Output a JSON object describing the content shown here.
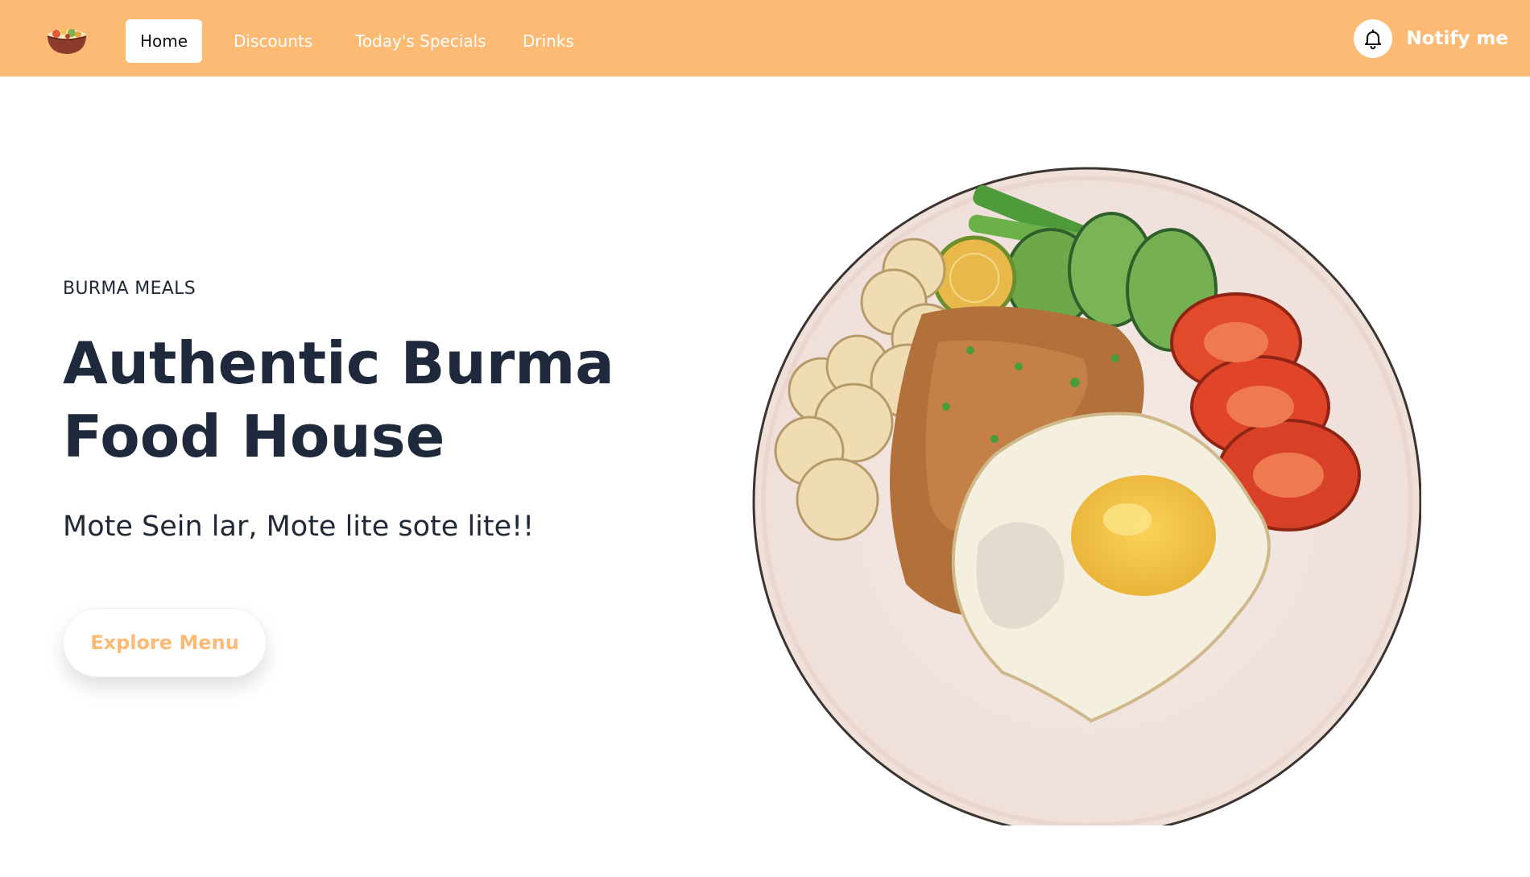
{
  "nav": {
    "logo_icon": "food-bowl-icon",
    "links": [
      {
        "label": "Home",
        "active": true
      },
      {
        "label": "Discounts",
        "active": false
      },
      {
        "label": "Today's Specials",
        "active": false
      },
      {
        "label": "Drinks",
        "active": false
      }
    ],
    "notify": {
      "label": "Notify me",
      "icon": "bell-icon"
    }
  },
  "hero": {
    "eyebrow": "BURMA MEALS",
    "title_line1": "Authentic Burma",
    "title_line2": "Food House",
    "subtitle": "Mote Sein lar, Mote lite sote lite!!",
    "cta_label": "Explore Menu",
    "image_icon": "fried-rice-plate-illustration"
  },
  "colors": {
    "brand": "#fdba74",
    "heading": "#1e293b",
    "body_text": "#1f2937",
    "background": "#ffffff"
  }
}
